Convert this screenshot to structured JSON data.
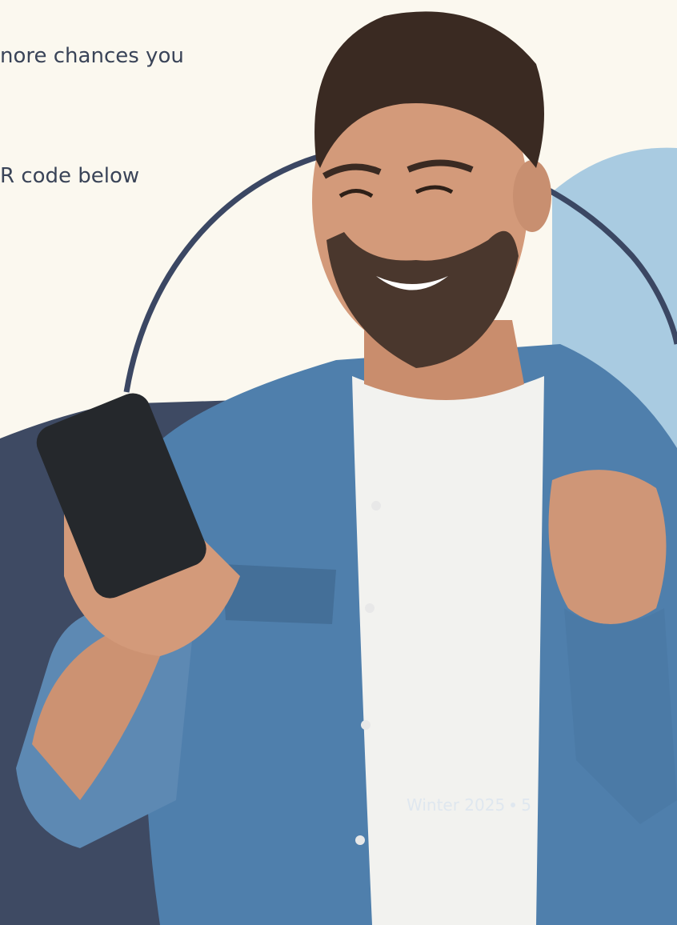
{
  "body_text": {
    "line1": "nore chances you",
    "line2": "R code below"
  },
  "footer": {
    "season": "Winter 2025",
    "page_number": "5"
  },
  "colors": {
    "background": "#fbf8ef",
    "navy_panel": "#3e4a63",
    "arch_stroke": "#3b4763",
    "light_blue_panel": "#a9cbe1",
    "denim": "#4f7fac",
    "tshirt": "#f2f2ef",
    "skin": "#d39a7a",
    "hair_beard": "#3a2a22",
    "phone": "#25282c",
    "footer_text": "#dfe7ef"
  },
  "image": {
    "subject": "smiling-man-with-phone-photo"
  }
}
